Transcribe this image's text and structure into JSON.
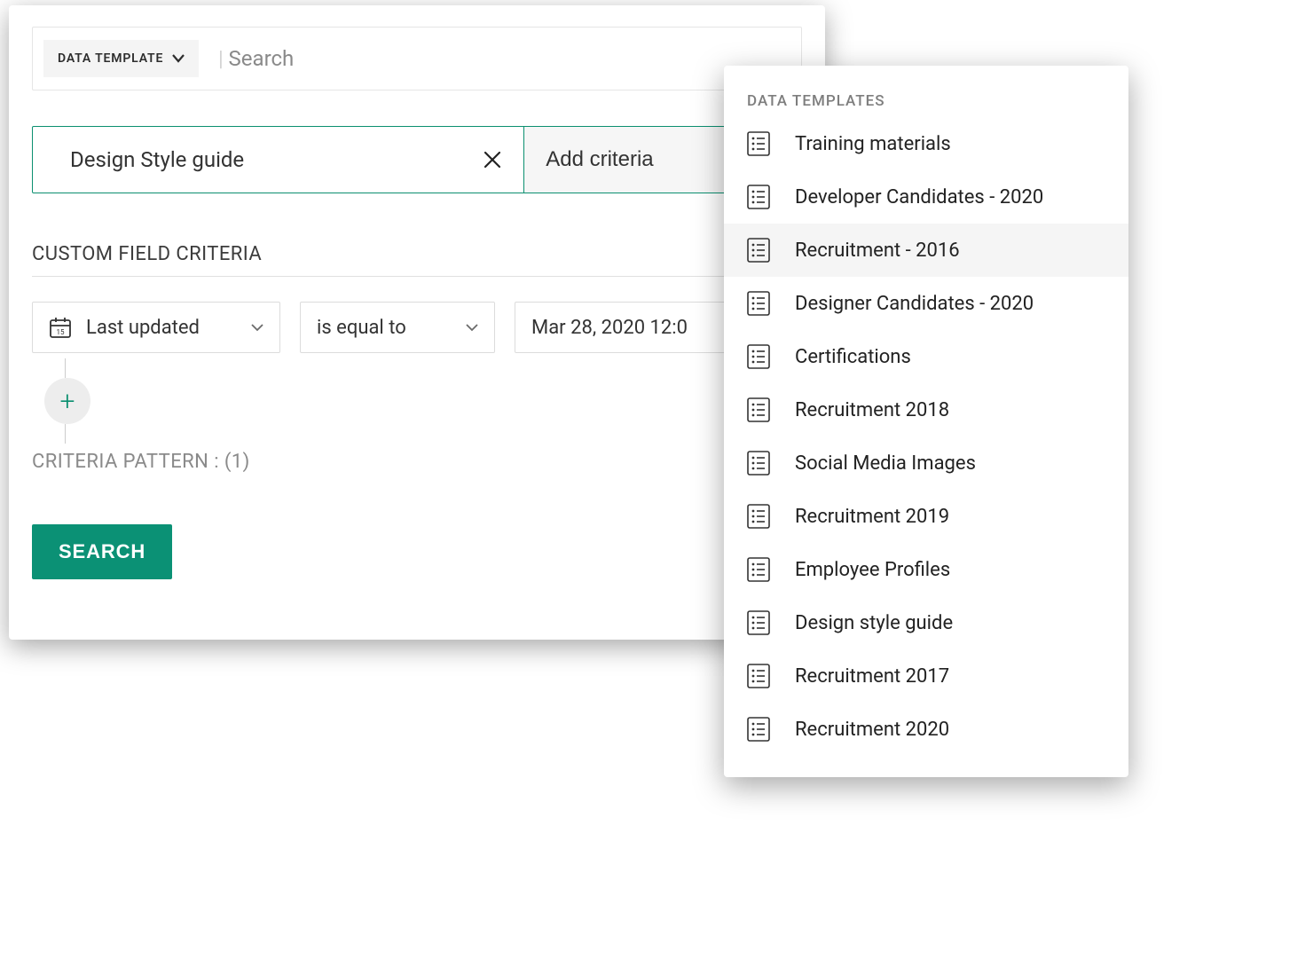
{
  "topbar": {
    "chip_label": "DATA TEMPLATE",
    "search_placeholder": "Search"
  },
  "chosen": {
    "template_name": "Design Style guide",
    "add_criteria_label": "Add criteria"
  },
  "criteria": {
    "section_label": "CUSTOM FIELD CRITERIA",
    "field": "Last updated",
    "operator": "is equal to",
    "value": "Mar 28, 2020 12:0",
    "pattern_label": "CRITERIA PATTERN :",
    "pattern_value": "(1)"
  },
  "actions": {
    "search_label": "SEARCH"
  },
  "dropdown": {
    "header": "DATA TEMPLATES",
    "items": [
      {
        "label": "Training materials"
      },
      {
        "label": "Developer Candidates - 2020"
      },
      {
        "label": "Recruitment - 2016",
        "hover": true
      },
      {
        "label": "Designer Candidates - 2020"
      },
      {
        "label": "Certifications"
      },
      {
        "label": "Recruitment 2018"
      },
      {
        "label": "Social Media Images"
      },
      {
        "label": "Recruitment 2019"
      },
      {
        "label": "Employee Profiles"
      },
      {
        "label": "Design style guide"
      },
      {
        "label": "Recruitment 2017"
      },
      {
        "label": "Recruitment 2020"
      }
    ]
  },
  "colors": {
    "accent": "#0b9175",
    "border_accent": "#0b8f70"
  }
}
